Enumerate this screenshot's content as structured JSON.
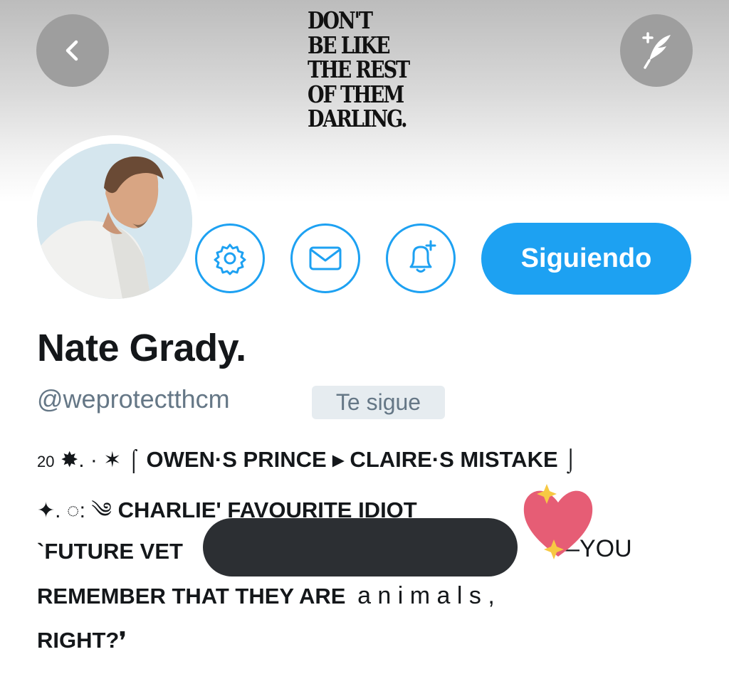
{
  "banner": {
    "quote_lines": [
      "DON'T",
      "BE LIKE",
      "THE REST",
      "OF THEM",
      "DARLING."
    ]
  },
  "nav": {
    "back_icon": "chevron-left-icon",
    "compose_icon": "feather-plus-icon"
  },
  "actions": {
    "settings_icon": "gear-icon",
    "message_icon": "envelope-icon",
    "notify_icon": "bell-plus-icon",
    "follow_label": "Siguiendo"
  },
  "profile": {
    "name": "Nate Grady.",
    "handle": "@weprotectthcm",
    "follows_you": "Te sigue"
  },
  "bio": {
    "line1_prefix": "20",
    "line1_symbols": "✸. · ✶ ⌠",
    "line1_text": "OWEN·S PRINCE ▸ CLAIRE·S MISTAKE ⌡",
    "line2_symbols": "✦.  ◌:  ༄",
    "line2_text": "CHARLIE' FAVOURITE IDIOT",
    "line2_suffix": "-",
    "line3_start": "`FUTURE VET",
    "line3_end": "—YOU",
    "line4_caps": "REMEMBER THAT THEY ARE",
    "line4_spaced": "a n i m a l s ,",
    "line5": "RIGHT?❜"
  },
  "colors": {
    "accent": "#1da1f2",
    "text": "#14171a",
    "secondary": "#657786",
    "heart": "#e65d75",
    "sparkle": "#f7c943"
  }
}
